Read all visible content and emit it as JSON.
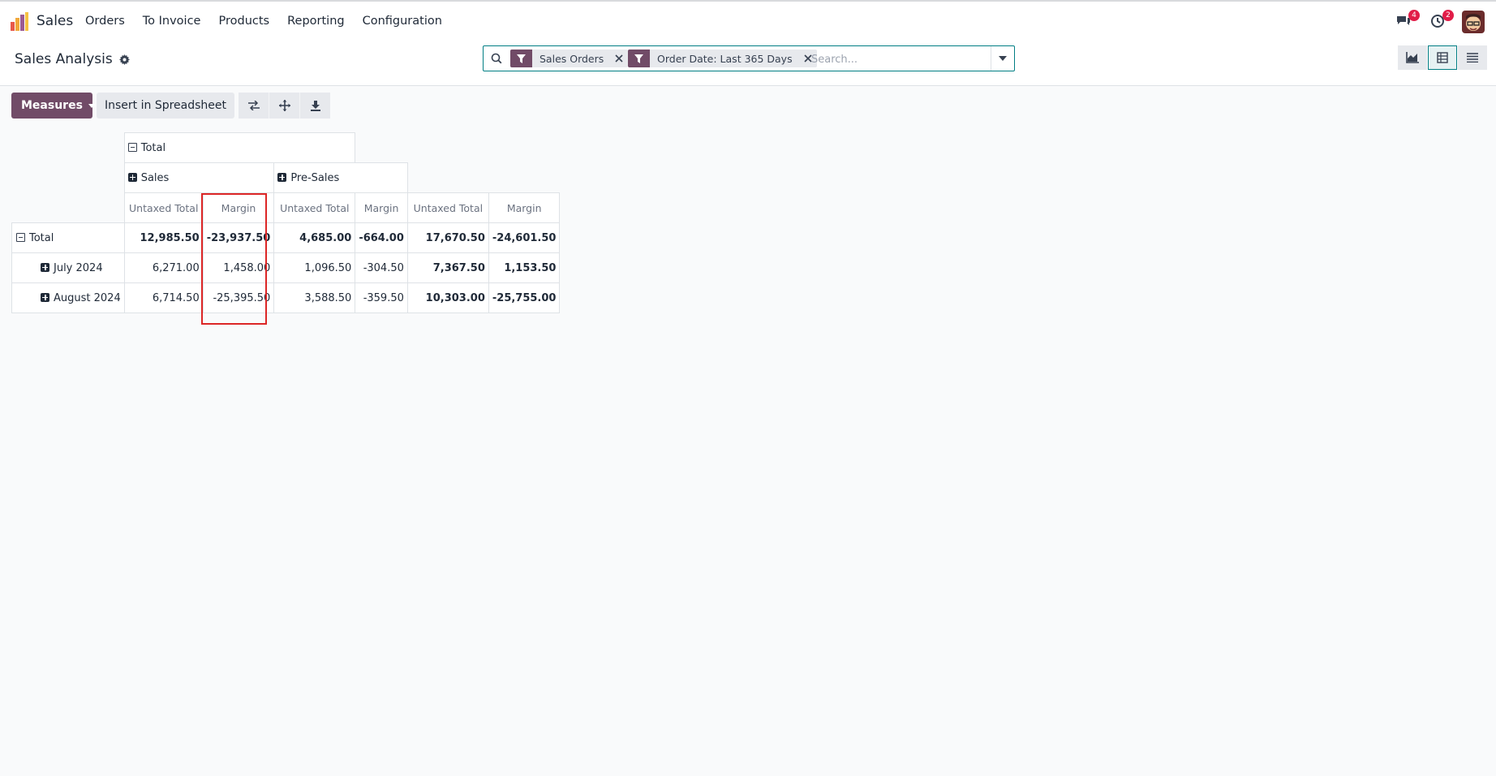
{
  "navbar": {
    "app_name": "Sales",
    "menu": [
      {
        "label": "Orders"
      },
      {
        "label": "To Invoice"
      },
      {
        "label": "Products"
      },
      {
        "label": "Reporting"
      },
      {
        "label": "Configuration"
      }
    ],
    "messages_count": "4",
    "activities_count": "2"
  },
  "control_panel": {
    "title": "Sales Analysis",
    "search": {
      "facets": [
        {
          "label": "Sales Orders"
        },
        {
          "label": "Order Date: Last 365 Days"
        }
      ],
      "placeholder": "Search..."
    },
    "views": [
      "graph-view",
      "pivot-view",
      "list-view"
    ],
    "active_view": "pivot-view"
  },
  "toolbar": {
    "measures_label": "Measures",
    "insert_label": "Insert in Spreadsheet"
  },
  "pivot": {
    "col_root": "Total",
    "col_groups": [
      {
        "label": "Sales"
      },
      {
        "label": "Pre-Sales"
      }
    ],
    "measures": [
      "Untaxed Total",
      "Margin",
      "Untaxed Total",
      "Margin",
      "Untaxed Total",
      "Margin"
    ],
    "rows": [
      {
        "label": "Total",
        "values": [
          "12,985.50",
          "-23,937.50",
          "4,685.00",
          "-664.00",
          "17,670.50",
          "-24,601.50"
        ]
      },
      {
        "label": "July 2024",
        "values": [
          "6,271.00",
          "1,458.00",
          "1,096.50",
          "-304.50",
          "7,367.50",
          "1,153.50"
        ]
      },
      {
        "label": "August 2024",
        "values": [
          "6,714.50",
          "-25,395.50",
          "3,588.50",
          "-359.50",
          "10,303.00",
          "-25,755.00"
        ]
      }
    ]
  },
  "colors": {
    "brand": "#714b67",
    "accent": "#017e84",
    "highlight": "#dc2626",
    "badge": "#e11d48"
  }
}
